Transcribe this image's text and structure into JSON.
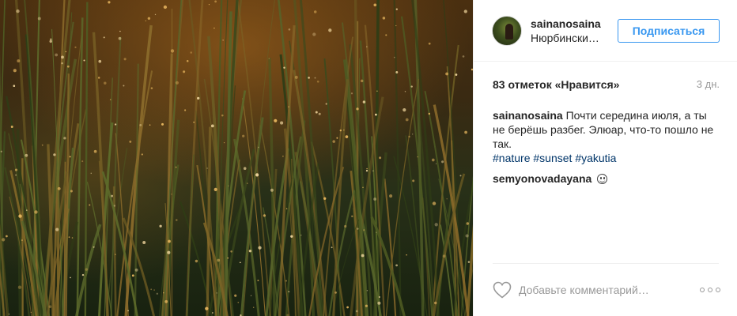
{
  "post": {
    "username": "sainanosaina",
    "location": "Нюрбински…",
    "follow_label": "Подписаться",
    "likes_text": "83 отметок «Нравится»",
    "time_ago": "3 дн.",
    "caption_user": "sainanosaina",
    "caption_text": " Почти середина июля, а ты не берёшь разбег. Элюар, что-то пошло не так.",
    "hashtags": [
      "#nature",
      "#sunset",
      "#yakutia"
    ],
    "comment": {
      "user": "semyonovadayana",
      "emoji": "smiling-face"
    },
    "comment_placeholder": "Добавьте комментарий…"
  },
  "colors": {
    "accent": "#3897f0",
    "hashtag": "#003569",
    "muted": "#999999",
    "text": "#262626"
  },
  "icons": [
    "heart-icon",
    "more-options-icon"
  ]
}
